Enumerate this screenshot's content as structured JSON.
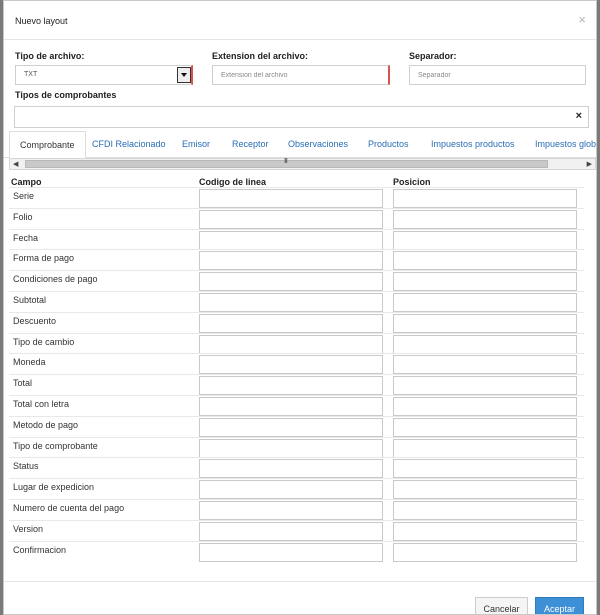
{
  "modal": {
    "title": "Nuevo layout",
    "close_icon": "×"
  },
  "form": {
    "tipo_archivo": {
      "label": "Tipo de archivo:",
      "value": "TXT"
    },
    "extension": {
      "label": "Extension del archivo:",
      "placeholder": "Extension del archivo"
    },
    "separador": {
      "label": "Separador:",
      "placeholder": "Separador"
    },
    "tipos_comprobantes": {
      "label": "Tipos de comprobantes",
      "clear_icon": "×"
    }
  },
  "tabs": [
    {
      "label": "Comprobante",
      "active": true
    },
    {
      "label": "CFDI Relacionado"
    },
    {
      "label": "Emisor"
    },
    {
      "label": "Receptor"
    },
    {
      "label": "Observaciones"
    },
    {
      "label": "Productos"
    },
    {
      "label": "Impuestos productos"
    },
    {
      "label": "Impuestos globa"
    }
  ],
  "scrollbar": {
    "left_arrow": "◀",
    "right_arrow": "▶",
    "grip": "III"
  },
  "table": {
    "headers": {
      "campo": "Campo",
      "codigo": "Codigo de linea",
      "posicion": "Posicion"
    },
    "rows": [
      "Serie",
      "Folio",
      "Fecha",
      "Forma de pago",
      "Condiciones de pago",
      "Subtotal",
      "Descuento",
      "Tipo de cambio",
      "Moneda",
      "Total",
      "Total con letra",
      "Metodo de pago",
      "Tipo de comprobante",
      "Status",
      "Lugar de expedicion",
      "Numero de cuenta del pago",
      "Version",
      "Confirmacion"
    ]
  },
  "footer": {
    "cancel_label": "Cancelar",
    "accept_label": "Aceptar"
  }
}
